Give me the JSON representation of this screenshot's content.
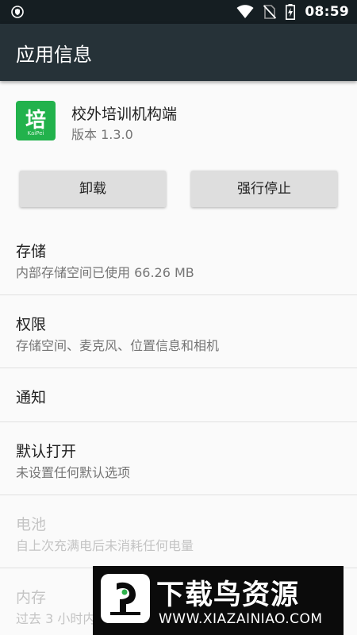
{
  "status_bar": {
    "time": "08:59",
    "icons": [
      "shield-icon",
      "wifi-icon",
      "no-sim-icon",
      "battery-charging-icon"
    ]
  },
  "app_bar": {
    "title": "应用信息"
  },
  "app": {
    "icon_char": "培",
    "icon_small_text": "KaiPei",
    "name": "校外培训机构端",
    "version": "版本 1.3.0",
    "icon_color": "#22b24c"
  },
  "buttons": {
    "uninstall": "卸载",
    "force_stop": "强行停止"
  },
  "settings": {
    "storage": {
      "title": "存储",
      "subtitle": "内部存储空间已使用 66.26 MB"
    },
    "permissions": {
      "title": "权限",
      "subtitle": "存储空间、麦克风、位置信息和相机"
    },
    "notifications": {
      "title": "通知"
    },
    "open_by_default": {
      "title": "默认打开",
      "subtitle": "未设置任何默认选项"
    },
    "battery": {
      "title": "电池",
      "subtitle": "自上次充满电后未消耗任何电量"
    },
    "memory": {
      "title": "内存",
      "subtitle": "过去 3 小时内"
    }
  },
  "watermark": {
    "main": "下载鸟资源",
    "url": "WWW.XIAZAINIAO.COM"
  },
  "colors": {
    "status_bar": "#151e22",
    "app_bar": "#263238",
    "background": "#fafafa"
  }
}
